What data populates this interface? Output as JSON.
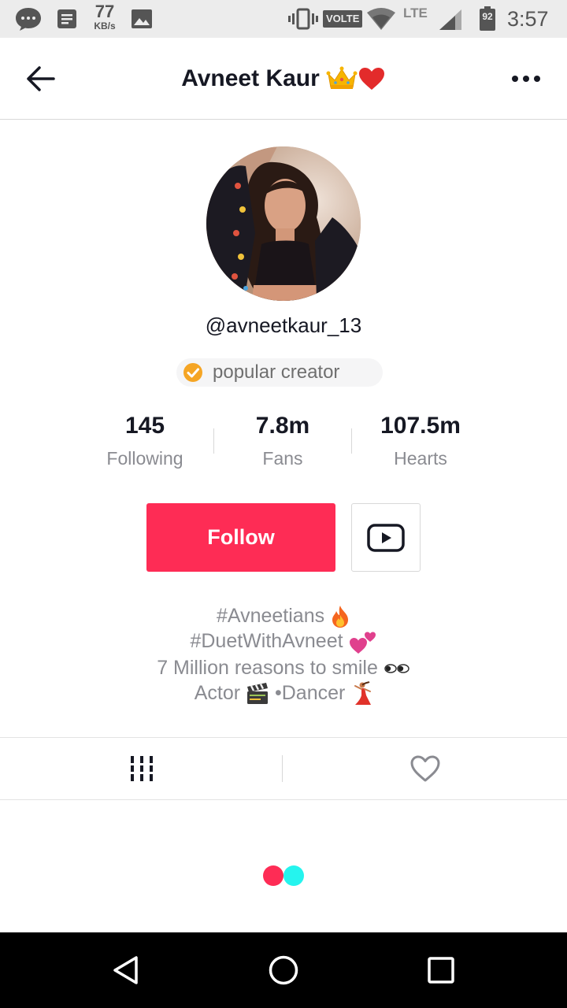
{
  "status_bar": {
    "speed_value": "77",
    "speed_unit": "KB/s",
    "volte_label": "VOLTE",
    "network_label": "LTE",
    "battery_level": "92",
    "time": "3:57"
  },
  "header": {
    "title": "Avneet Kaur",
    "title_emojis": [
      "crown-emoji",
      "red-heart-emoji"
    ],
    "back_icon": "arrow-left-icon",
    "more_icon": "more-horizontal-icon"
  },
  "profile": {
    "username": "@avneetkaur_13",
    "badge_label": "popular creator",
    "stats": [
      {
        "value": "145",
        "label": "Following"
      },
      {
        "value": "7.8m",
        "label": "Fans"
      },
      {
        "value": "107.5m",
        "label": "Hearts"
      }
    ],
    "follow_label": "Follow",
    "youtube_icon": "youtube-icon",
    "bio_lines": [
      "#Avneetians ",
      "#DuetWithAvneet ",
      "7 Million reasons to smile",
      "Actor",
      "•Dancer"
    ]
  },
  "tabs": [
    {
      "name": "videos",
      "icon": "grid-icon"
    },
    {
      "name": "liked",
      "icon": "heart-outline-icon"
    }
  ],
  "nav_bar": {
    "icons": [
      "back-triangle-icon",
      "home-circle-icon",
      "recents-square-icon"
    ]
  },
  "colors": {
    "accent": "#fe2c55",
    "loader_cyan": "#25f4ee",
    "verified": "#f5a524"
  }
}
